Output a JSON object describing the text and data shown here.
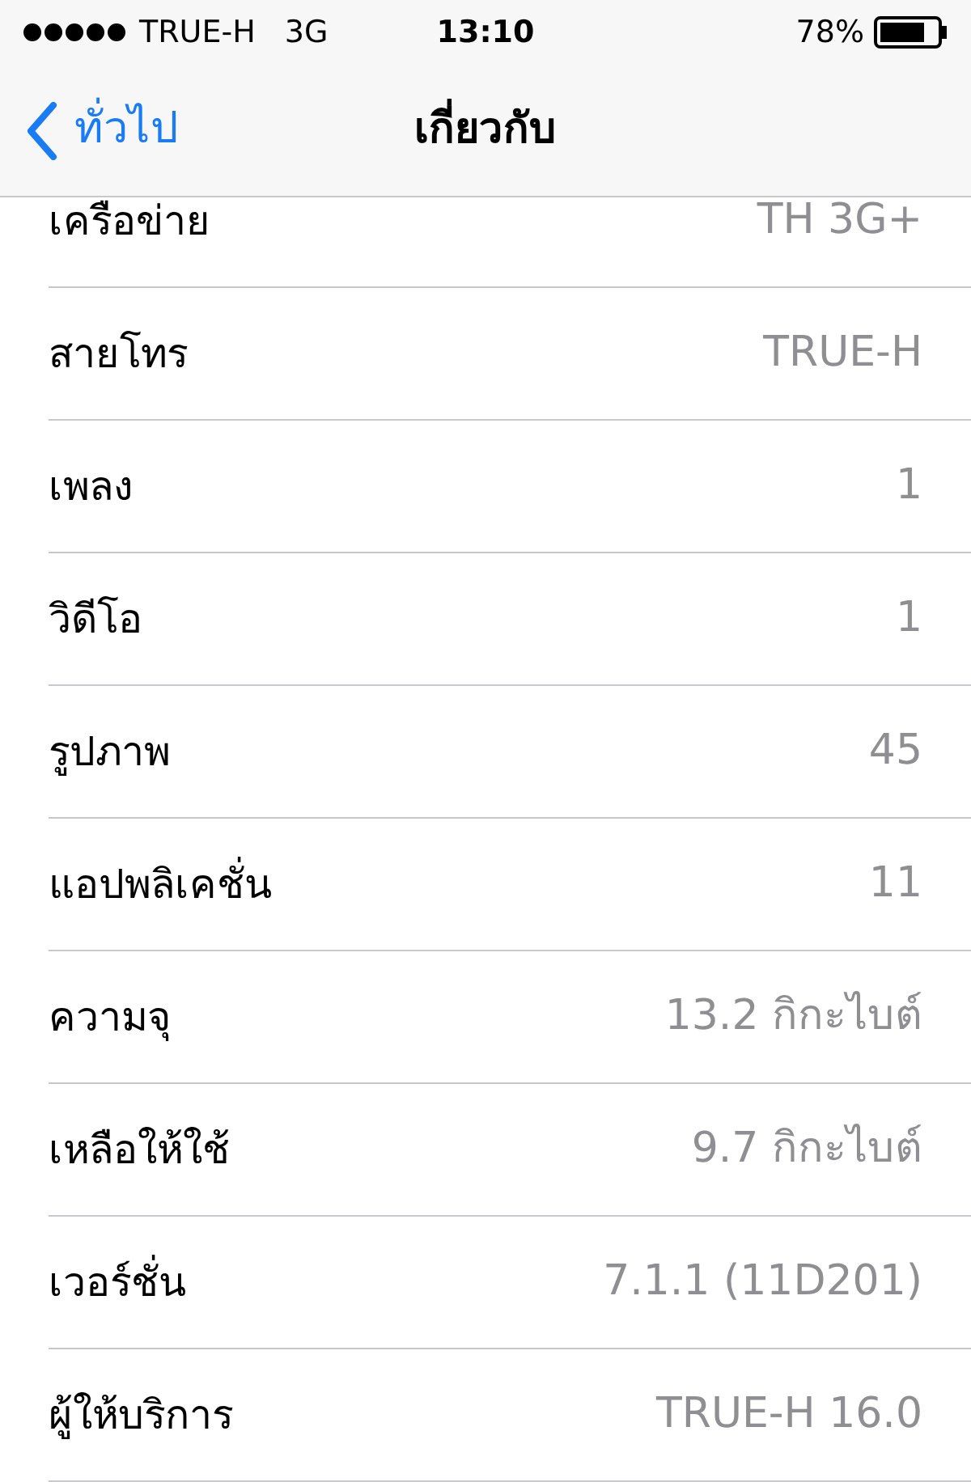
{
  "status_bar": {
    "carrier": "TRUE-H",
    "network": "3G",
    "time": "13:10",
    "battery": "78%"
  },
  "nav_bar": {
    "back": "ทั่วไป",
    "title": "เกี่ยวกับ"
  },
  "rows": [
    {
      "label": "เครือข่าย",
      "value": "TH 3G+"
    },
    {
      "label": "สายโทร",
      "value": "TRUE-H"
    },
    {
      "label": "เพลง",
      "value": "1"
    },
    {
      "label": "วิดีโอ",
      "value": "1"
    },
    {
      "label": "รูปภาพ",
      "value": "45"
    },
    {
      "label": "แอปพลิเคชั่น",
      "value": "11"
    },
    {
      "label": "ความจุ",
      "value": "13.2 กิกะไบต์"
    },
    {
      "label": "เหลือให้ใช้",
      "value": "9.7 กิกะไบต์"
    },
    {
      "label": "เวอร์ชั่น",
      "value": "7.1.1 (11D201)"
    },
    {
      "label": "ผู้ให้บริการ",
      "value": "TRUE-H 16.0"
    }
  ]
}
